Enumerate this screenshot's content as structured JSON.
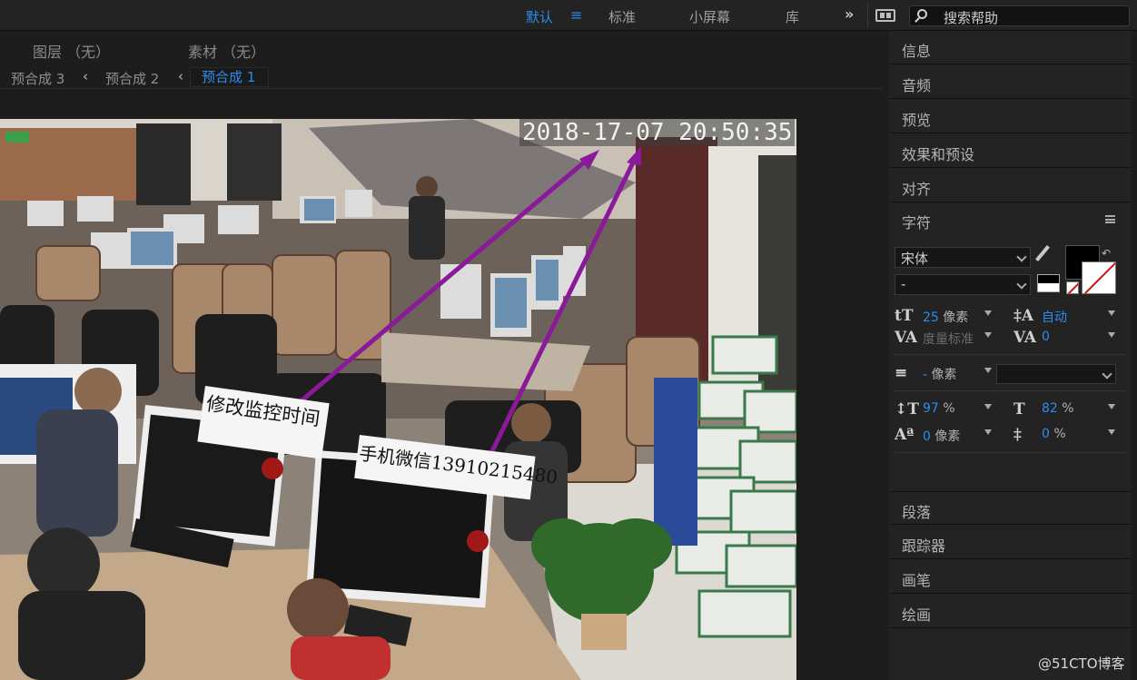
{
  "workspaces": {
    "items": [
      "默认",
      "标准",
      "小屏幕",
      "库"
    ],
    "more": "»",
    "search_placeholder": "搜索帮助"
  },
  "viewer": {
    "layer_label": "图层 （无）",
    "footage_label": "素材 （无）",
    "breadcrumbs": [
      "预合成 3",
      "预合成 2",
      "预合成 1"
    ],
    "chevron": "‹"
  },
  "image": {
    "timestamp": "2018-17-07 20:50:35",
    "annotation_1": "修改监控时间",
    "annotation_2": "手机微信13910215480",
    "arrow_color": "#8a1a9a"
  },
  "panels": {
    "top_items": [
      "信息",
      "音频",
      "预览",
      "效果和预设",
      "对齐"
    ],
    "character_title": "字符",
    "bottom_items": [
      "段落",
      "跟踪器",
      "画笔",
      "绘画"
    ]
  },
  "character": {
    "font_family": "宋体",
    "font_style": "-",
    "size_value": "25",
    "size_unit": "像素",
    "leading_value": "自动",
    "kerning_label": "度量标准",
    "tracking_value": "0",
    "stroke_value": "-",
    "stroke_unit": "像素",
    "vscale_value": "97",
    "vscale_unit": "%",
    "hscale_value": "82",
    "hscale_unit": "%",
    "baseline_value": "0",
    "baseline_unit": "像素",
    "tsume_value": "0",
    "tsume_unit": "%",
    "style_buttons": [
      "T",
      "T",
      "TT",
      "Tт",
      "T¹",
      "T₁"
    ],
    "fill_color": "#000000"
  },
  "watermark": "@51CTO博客",
  "colors": {
    "accent": "#2d8ceb",
    "panel_bg": "#232323"
  }
}
